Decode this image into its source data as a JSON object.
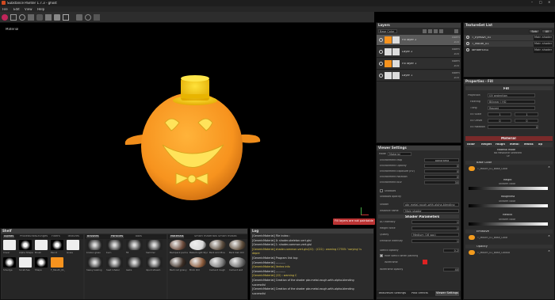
{
  "app": {
    "title": "Substance Painter 1.7.3 - ghost"
  },
  "menu": [
    "File",
    "Edit",
    "View",
    "Help"
  ],
  "viewport": {
    "label": "Material",
    "status": "Fill layers are not paintable"
  },
  "layers": {
    "title": "Layers",
    "channel": "Base Color",
    "items": [
      {
        "name": "Fill layer 2",
        "blend": "Norm",
        "opacity": "100"
      },
      {
        "name": "Layer 2",
        "blend": "Norm",
        "opacity": "100"
      },
      {
        "name": "Fill layer 1",
        "blend": "Norm",
        "opacity": "100"
      },
      {
        "name": "Layer 1",
        "blend": "Norm",
        "opacity": "100"
      }
    ]
  },
  "textureset": {
    "title": "TextureSet List",
    "solo": "Solo",
    "all": "All",
    "items": [
      {
        "name": "T_Eyes&R_01",
        "shader": "Main shader"
      },
      {
        "name": "T_Mouth_01",
        "shader": "Main shader"
      },
      {
        "name": "lambert3SG",
        "shader": "Main shader"
      }
    ]
  },
  "viewer": {
    "title": "Viewer Settings",
    "mode_label": "Mode",
    "mode_value": "Material",
    "rows": [
      {
        "label": "Environment Map",
        "value": "panorama"
      },
      {
        "label": "Environment Opacity",
        "value": "0"
      },
      {
        "label": "Environment Exposure (EV)",
        "value": "0"
      },
      {
        "label": "Environment Rotation",
        "value": "0"
      },
      {
        "label": "Environment Blur",
        "value": "35"
      }
    ],
    "shadows": "Shadows",
    "shadows_opacity": "Shadows opacity",
    "shader_label": "Shader",
    "shader_value": "pbr-metal-rough-with-alpha-blending",
    "instance_label": "Instance name",
    "instance_value": "Main shader",
    "params_title": "Shader Parameters",
    "params": [
      {
        "label": "AO Intensity",
        "value": "1"
      },
      {
        "label": "Height force",
        "value": "1"
      },
      {
        "label": "Quality",
        "value": "Medium (16 spp)"
      },
      {
        "label": "Emissive Intensity",
        "value": "1"
      }
    ],
    "stencil": "Stencil opacity",
    "stencil_val": "0.2",
    "hide_stencil": "Hide stencil when painting",
    "wireframe": "Wireframe",
    "wireframe_opacity": "Wireframe opacity",
    "wireframe_val": "40",
    "tabs": [
      "TextureSet Settings",
      "Post Effects",
      "Viewer Settings"
    ]
  },
  "properties": {
    "title": "Properties - Fill",
    "fill": "Fill",
    "projection_label": "Projection",
    "projection_value": "UV projection",
    "filtering_label": "Filtering",
    "filtering_value": "Bilinear | HQ",
    "tiling_label": "Tiling",
    "tiling_value": "Repeat",
    "uvscale": "UV Scale",
    "uvoffset": "UV Offset",
    "uvrot": "UV Rotation",
    "uvscale_vals": [
      "1",
      "1"
    ],
    "uvoffset_vals": [
      "0",
      "0"
    ],
    "uvrot_val": "0",
    "material": "Material",
    "channels": [
      "color",
      "height",
      "rough",
      "metal",
      "emiss",
      "op"
    ],
    "material_mode": "Material mode",
    "no_resource": "No Resource Selected",
    "or": "Or",
    "base_color": "Base Color",
    "base_tex": "T_Mouth_01_Base_Color",
    "height": "Height",
    "uniform": "uniform color",
    "roughness": "Roughness",
    "metallic": "Metallic",
    "emissive": "Emissive",
    "emissive_tex": "T_Mouth_01_Base_Color",
    "opacity": "Opacity",
    "opacity_tex": "T_Mouth_01_Base_Colouo"
  },
  "shelf": {
    "title": "Shelf",
    "tabs1": [
      "Alphas",
      "Procedurals",
      "Grunges",
      "Filters",
      "Textures"
    ],
    "items1": [
      "Cover",
      "Alpha Shape",
      "Brush",
      "Pencil",
      "Grass",
      "Smudge",
      "Scratches",
      "Shape",
      "T_Mouth_01_Base_Color"
    ],
    "tabs2": [
      "Brushes",
      "Particles",
      "Tools"
    ],
    "items2": [
      "broken glass",
      "burn",
      "fill",
      "hammer",
      "heavy leaking",
      "heat inhaler",
      "leaks",
      "liquid stream"
    ],
    "tabs3": [
      "Materials",
      "Smart materials",
      "Smart masks"
    ],
    "items3": [
      "Backpack pad leather",
      "Baked Light Stylized",
      "Bark Arid Pine",
      "Bark Oak Old",
      "Bark red grainy",
      "Brick Old",
      "Cement rough",
      "Cement wet"
    ]
  },
  "log": {
    "title": "Log",
    "lines": [
      {
        "text": "[GenericMaterial] File index::",
        "c": "w"
      },
      {
        "text": "[GenericMaterial] 0: shader-skeleton.vert.glsl",
        "c": "w"
      },
      {
        "text": "[GenericMaterial] 1: shader-common.vert.glsl",
        "c": "w"
      },
      {
        "text": "[GenericMaterial] shader-common.vert.glsl(22) : (C22) : warning C7555: 'varying' is",
        "c": "y"
      },
      {
        "text": "depre",
        "c": "y"
      },
      {
        "text": "[GenericMaterial] Program link log:",
        "c": "w"
      },
      {
        "text": "[GenericMaterial] ----------",
        "c": "w"
      },
      {
        "text": "[GenericMaterial] Vertex info",
        "c": "y"
      },
      {
        "text": "[GenericMaterial] ----------",
        "c": "w"
      },
      {
        "text": "[GenericMaterial] (22) : warning C",
        "c": "y"
      },
      {
        "text": "[GenericMaterial] Creation of the shader pbr-metal-rough-with-alpha-blending",
        "c": "w"
      },
      {
        "text": "successful",
        "c": "w"
      },
      {
        "text": "[GenericMaterial] Creation of the shader pbr-metal-rough-with-alpha-blending",
        "c": "w"
      },
      {
        "text": "successful",
        "c": "w"
      }
    ]
  },
  "colors": {
    "accent": "#d84a2a",
    "orange": "#f7931e",
    "selected": "#5a5a5a"
  }
}
